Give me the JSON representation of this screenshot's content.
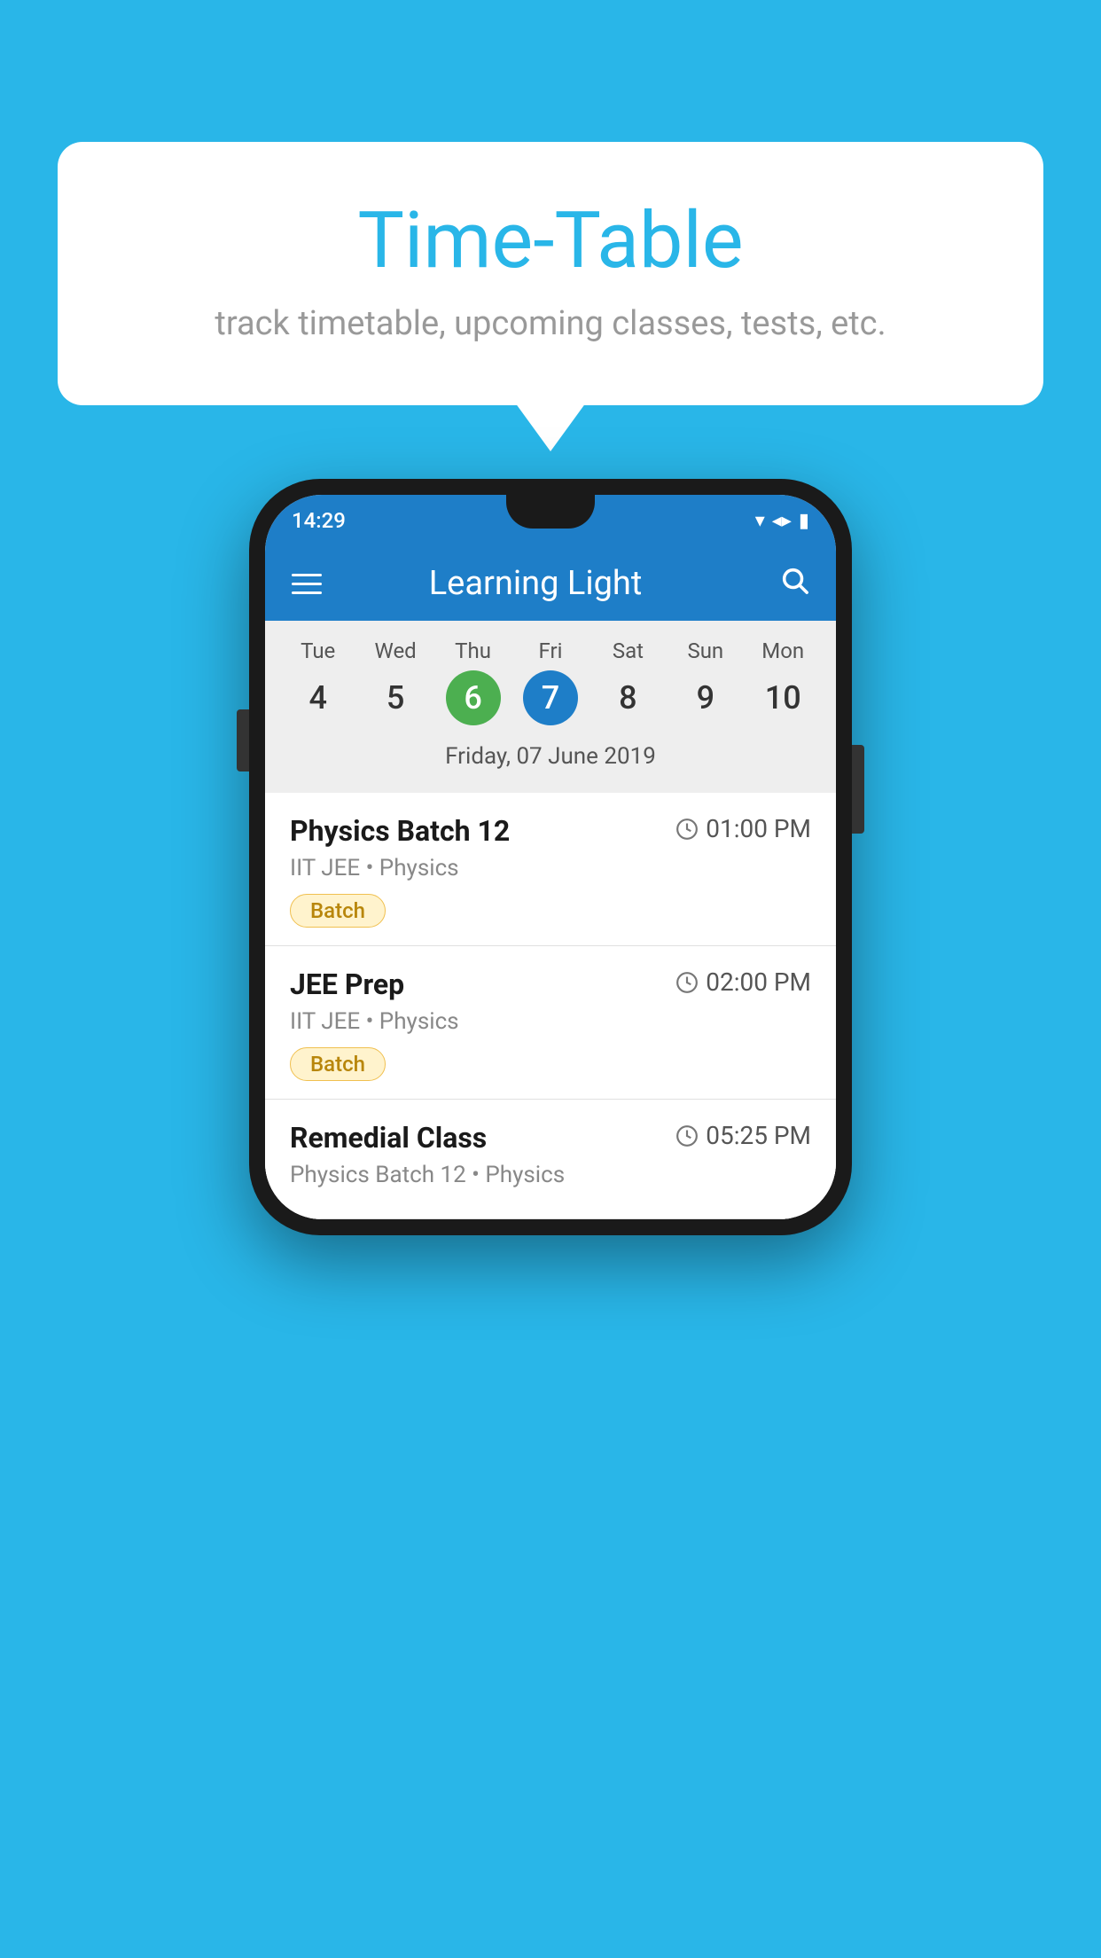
{
  "page": {
    "background_color": "#29b6e8"
  },
  "speech_bubble": {
    "title": "Time-Table",
    "subtitle": "track timetable, upcoming classes, tests, etc."
  },
  "phone": {
    "status_bar": {
      "time": "14:29"
    },
    "app_header": {
      "title": "Learning Light",
      "menu_icon_label": "menu",
      "search_icon_label": "search"
    },
    "calendar": {
      "days": [
        {
          "name": "Tue",
          "num": "4",
          "state": "normal"
        },
        {
          "name": "Wed",
          "num": "5",
          "state": "normal"
        },
        {
          "name": "Thu",
          "num": "6",
          "state": "today"
        },
        {
          "name": "Fri",
          "num": "7",
          "state": "selected"
        },
        {
          "name": "Sat",
          "num": "8",
          "state": "normal"
        },
        {
          "name": "Sun",
          "num": "9",
          "state": "normal"
        },
        {
          "name": "Mon",
          "num": "10",
          "state": "normal"
        }
      ],
      "selected_date_label": "Friday, 07 June 2019"
    },
    "classes": [
      {
        "id": "class-1",
        "name": "Physics Batch 12",
        "time": "01:00 PM",
        "meta": "IIT JEE • Physics",
        "badge": "Batch"
      },
      {
        "id": "class-2",
        "name": "JEE Prep",
        "time": "02:00 PM",
        "meta": "IIT JEE • Physics",
        "badge": "Batch"
      },
      {
        "id": "class-3",
        "name": "Remedial Class",
        "time": "05:25 PM",
        "meta": "Physics Batch 12 • Physics",
        "badge": null
      }
    ]
  }
}
